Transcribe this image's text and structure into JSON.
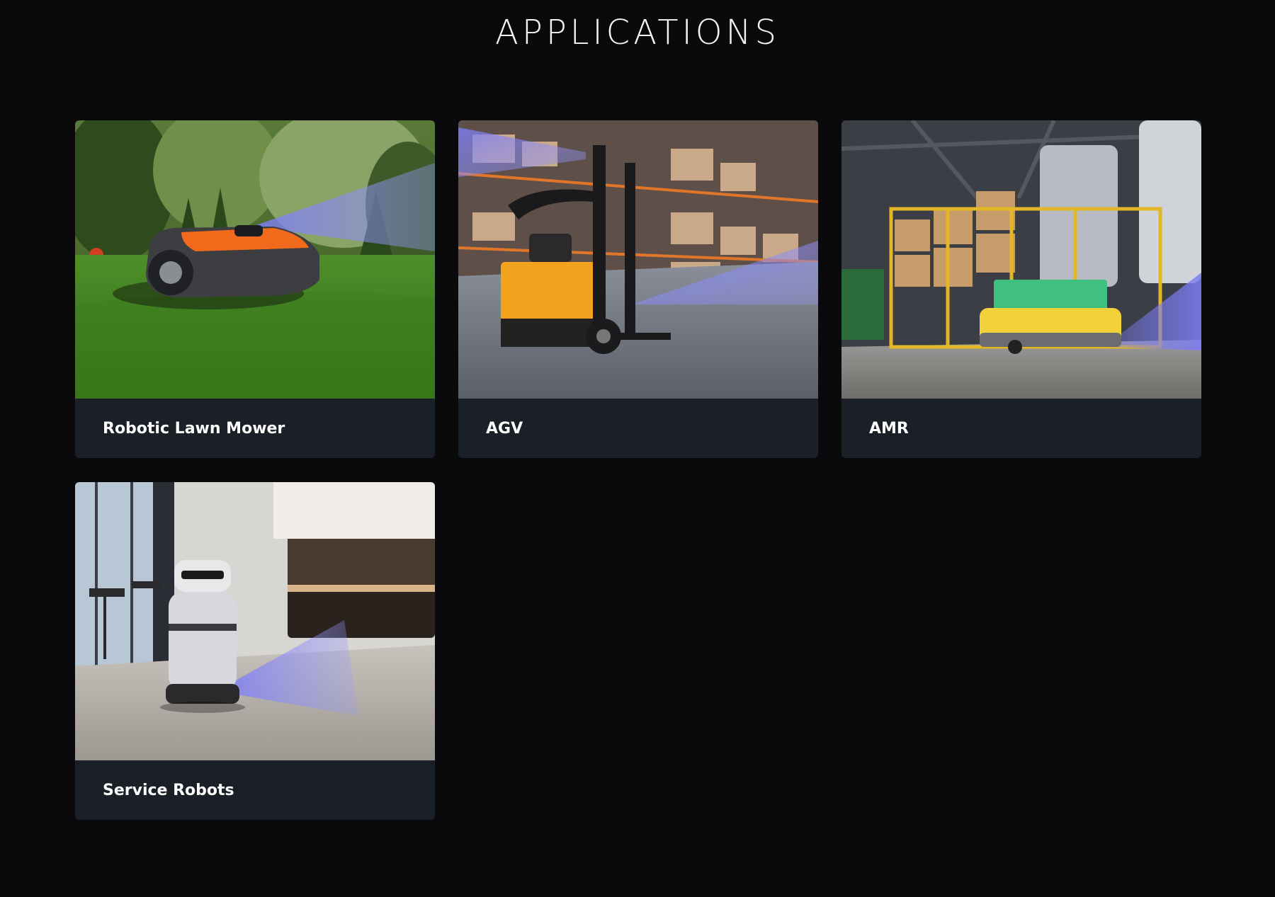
{
  "page": {
    "title": "APPLICATIONS"
  },
  "colors": {
    "background": "#0a0a0c",
    "card_caption_bg": "#1b1f28",
    "sensor_beam": "#7b7cf5"
  },
  "cards": [
    {
      "label": "Robotic Lawn Mower",
      "image": "robotic-lawn-mower-photo"
    },
    {
      "label": "AGV",
      "image": "forklift-agv-warehouse-photo"
    },
    {
      "label": "AMR",
      "image": "amr-warehouse-robot-photo"
    },
    {
      "label": "Service Robots",
      "image": "restaurant-service-robot-photo"
    }
  ]
}
